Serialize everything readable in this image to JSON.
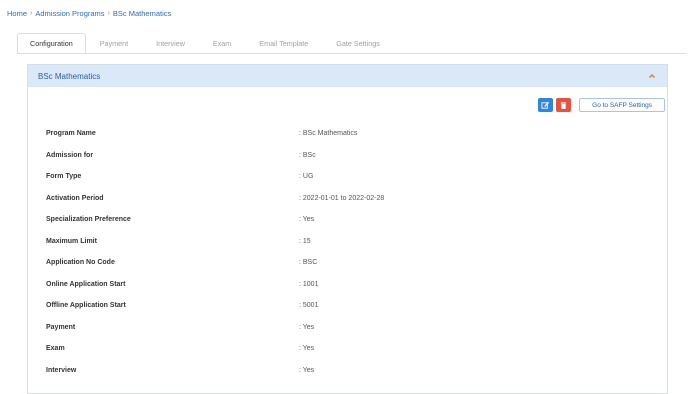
{
  "breadcrumb": [
    {
      "label": "Home"
    },
    {
      "label": "Admission Programs"
    },
    {
      "label": "BSc Mathematics"
    }
  ],
  "breadcrumb_separator": "›",
  "tabs": [
    {
      "label": "Configuration",
      "active": true
    },
    {
      "label": "Payment"
    },
    {
      "label": "Interview"
    },
    {
      "label": "Exam"
    },
    {
      "label": "Email Template"
    },
    {
      "label": "Gate Settings"
    }
  ],
  "panel": {
    "title": "BSc Mathematics",
    "saf_button": "Go to SAFP Settings"
  },
  "details": [
    {
      "label": "Program Name",
      "value": ": BSc Mathematics"
    },
    {
      "label": "Admission for",
      "value": ": BSc"
    },
    {
      "label": "Form Type",
      "value": ": UG"
    },
    {
      "label": "Activation Period",
      "value": ": 2022-01-01 to 2022-02-28"
    },
    {
      "label": "Specialization Preference",
      "value": ": Yes"
    },
    {
      "label": "Maximum Limit",
      "value": ": 15"
    },
    {
      "label": "Application No Code",
      "value": ": BSC"
    },
    {
      "label": "Online Application Start",
      "value": ": 1001"
    },
    {
      "label": "Offline Application Start",
      "value": ": 5001"
    },
    {
      "label": "Payment",
      "value": ": Yes"
    },
    {
      "label": "Exam",
      "value": ": Yes"
    },
    {
      "label": "Interview",
      "value": ": Yes"
    }
  ],
  "colors": {
    "accent": "#2b5f9e",
    "panel_header": "#dbe8f8",
    "edit_button": "#2e86de",
    "delete_button": "#e5533d",
    "collapse_chevron": "#e07a2e"
  }
}
